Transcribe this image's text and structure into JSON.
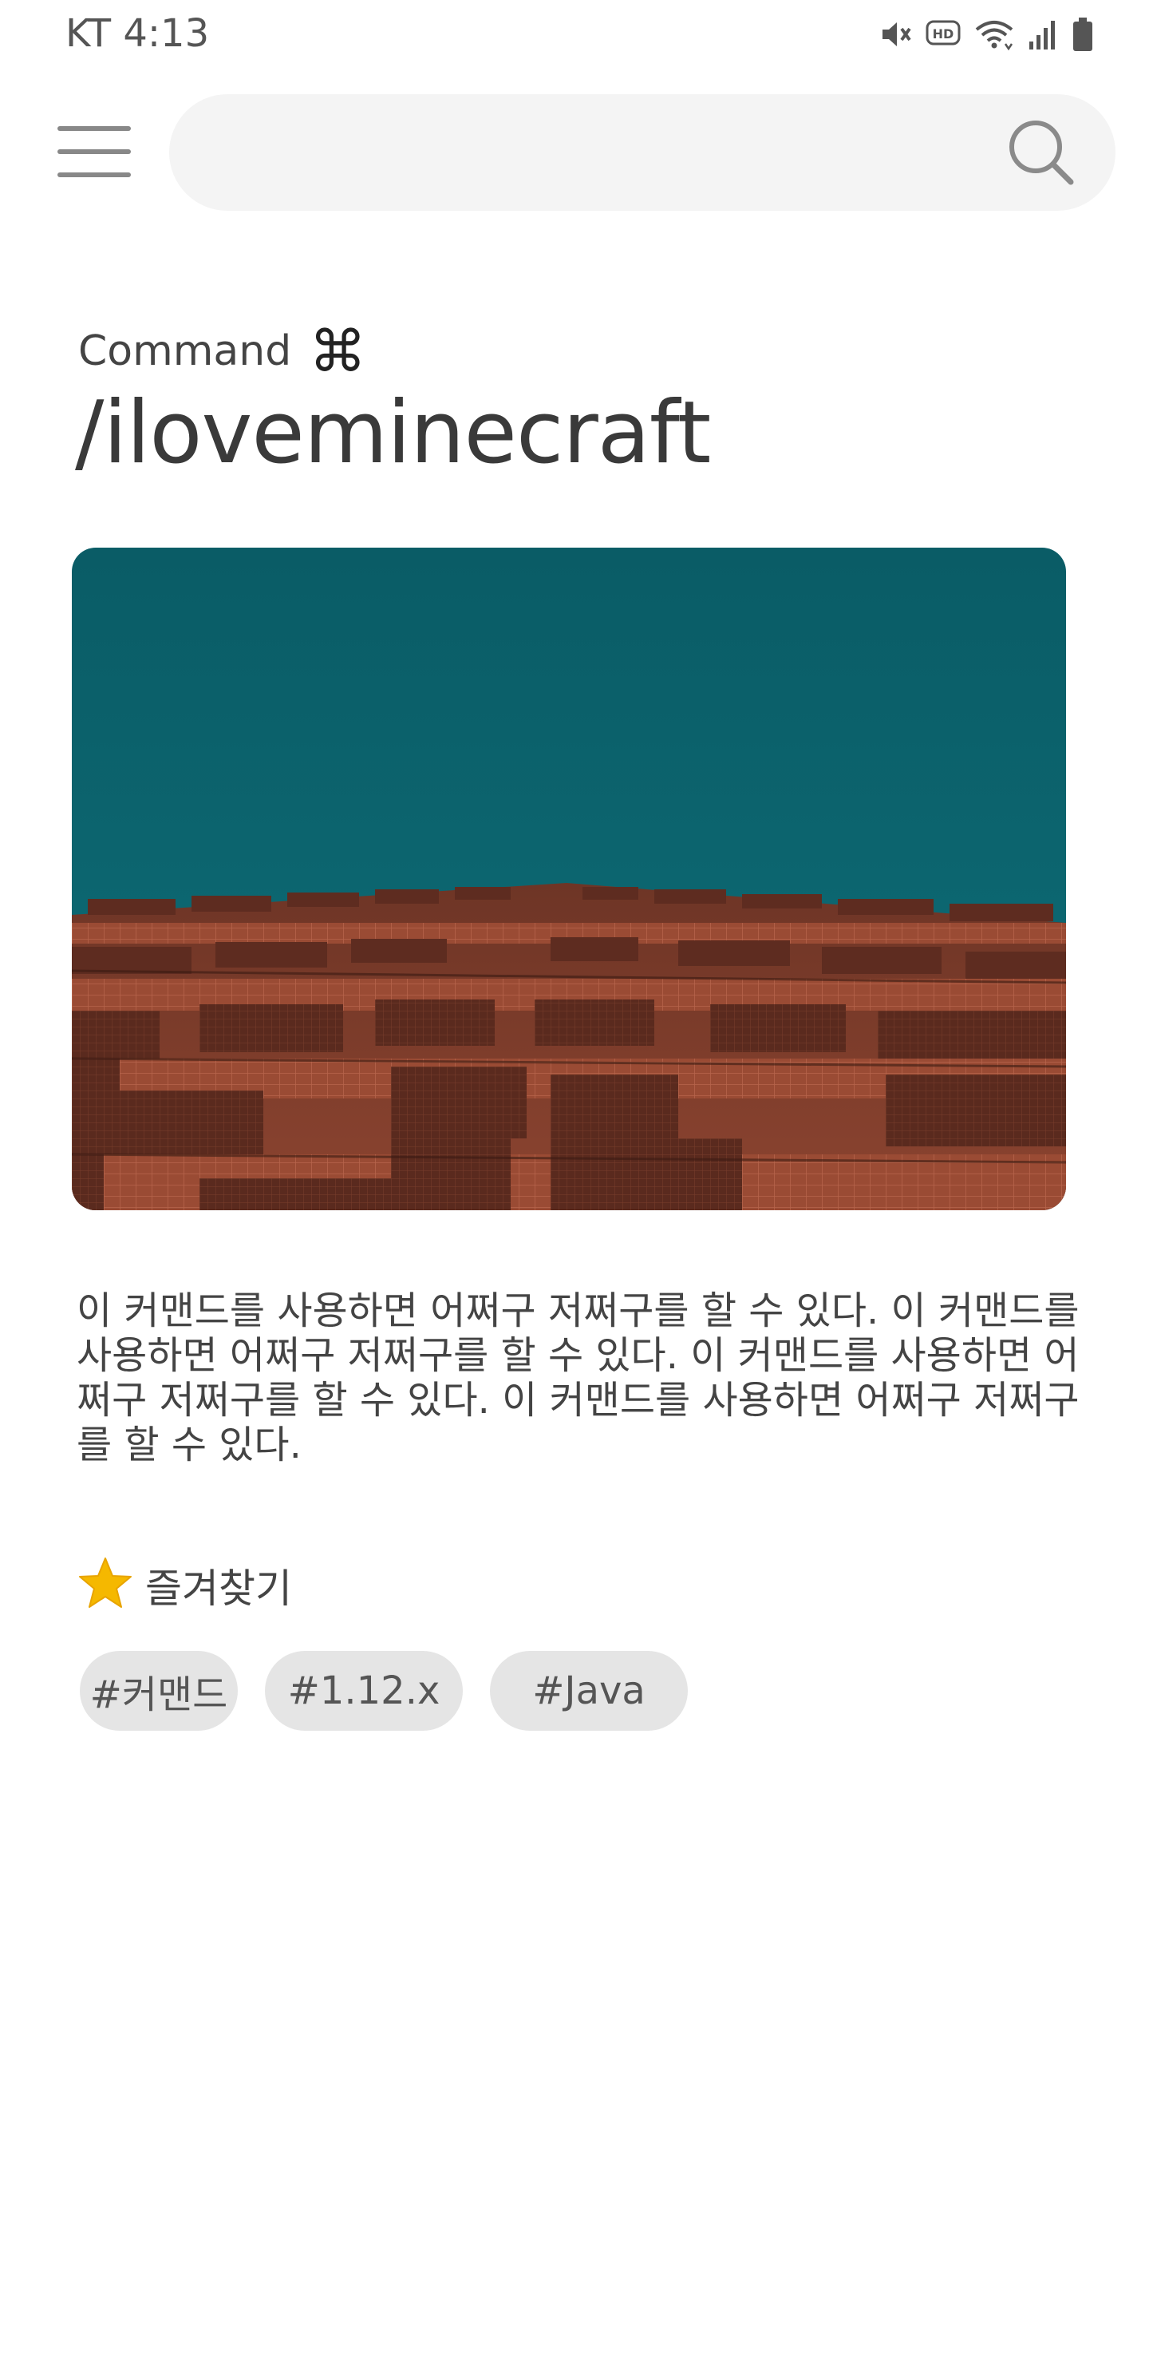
{
  "status_bar": {
    "time": "KT 4:13",
    "icons": [
      "mute-icon",
      "hd-icon",
      "wifi-icon",
      "signal-icon",
      "battery-icon"
    ],
    "hd_label": "HD"
  },
  "header": {
    "menu_icon": "hamburger-menu-icon",
    "search": {
      "value": "",
      "placeholder": "",
      "icon": "search-icon"
    }
  },
  "command": {
    "label": "Command",
    "glyph": "⌘",
    "title": "/iloveminecraft"
  },
  "image": {
    "description_icon": "building-photo",
    "colors": {
      "sky": "#0b6470",
      "brick": "#8a3f2c"
    }
  },
  "description": "이 커맨드를 사용하면 어쩌구 저쩌구를 할 수 있다. 이 커맨드를 사용하면 어쩌구 저쩌구를 할 수 있다. 이 커맨드를 사용하면 어쩌구 저쩌구를 할 수 있다. 이 커맨드를 사용하면 어쩌구 저쩌구를 할 수 있다.",
  "favorite": {
    "icon": "star-icon",
    "label": "즐겨찾기",
    "color": "#f5b800"
  },
  "tags": [
    "#커맨드",
    "#1.12.x",
    "#Java"
  ]
}
